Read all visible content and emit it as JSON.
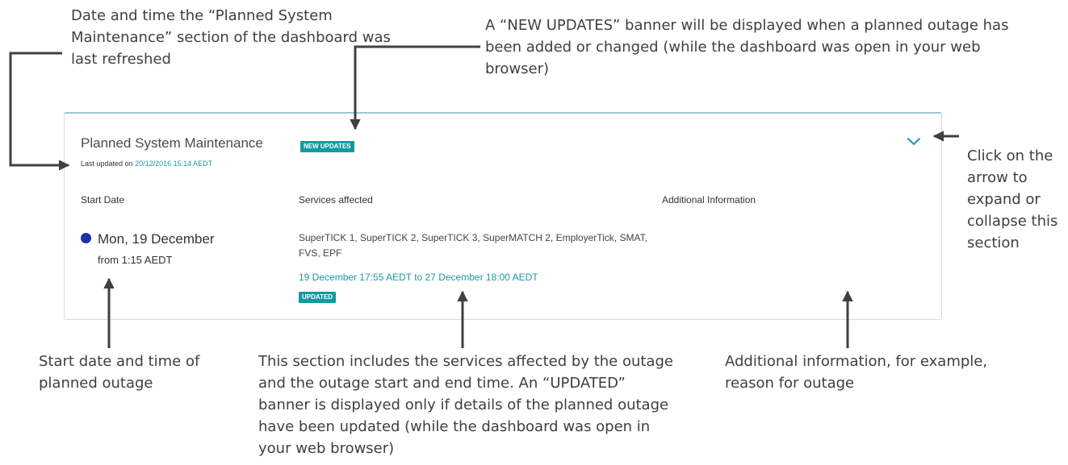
{
  "annotations": {
    "timestamp": "Date and time the “Planned System Maintenance” section of the dashboard was last refreshed",
    "new_updates": "A “NEW UPDATES” banner will be displayed when a planned outage has been added or changed (while the dashboard was open in your web browser)",
    "expand": "Click on the arrow to expand or collapse this section",
    "start": "Start date and time of planned outage",
    "services": "This section includes the services affected by the outage and the outage start and end time. An “UPDATED” banner is displayed only if details of the planned outage have been updated (while the dashboard was open in your web browser)",
    "additional": "Additional information, for example, reason for outage"
  },
  "panel": {
    "title": "Planned System Maintenance",
    "new_updates_badge": "NEW UPDATES",
    "last_updated_prefix": "Last updated on",
    "last_updated_value": "20/12/2016 15:14 AEDT",
    "columns": {
      "start": "Start Date",
      "services": "Services affected",
      "additional": "Additional Information"
    },
    "outage": {
      "start_date": "Mon, 19 December",
      "start_time": "from 1:15 AEDT",
      "services": "SuperTICK 1, SuperTICK 2, SuperTICK 3, SuperMATCH 2, EmployerTick, SMAT, FVS, EPF",
      "window": "19 December 17:55 AEDT to 27 December 18:00 AEDT",
      "updated_badge": "UPDATED",
      "additional_info": ""
    }
  },
  "icons": {
    "chevron": "chevron-down-icon",
    "status_dot": "status-dot-icon"
  },
  "colors": {
    "accent": "#139aa0",
    "link": "#1a9aa5",
    "dot": "#1f2fa8",
    "arrow": "#404040",
    "panel_top_border": "#9cc7d6"
  }
}
